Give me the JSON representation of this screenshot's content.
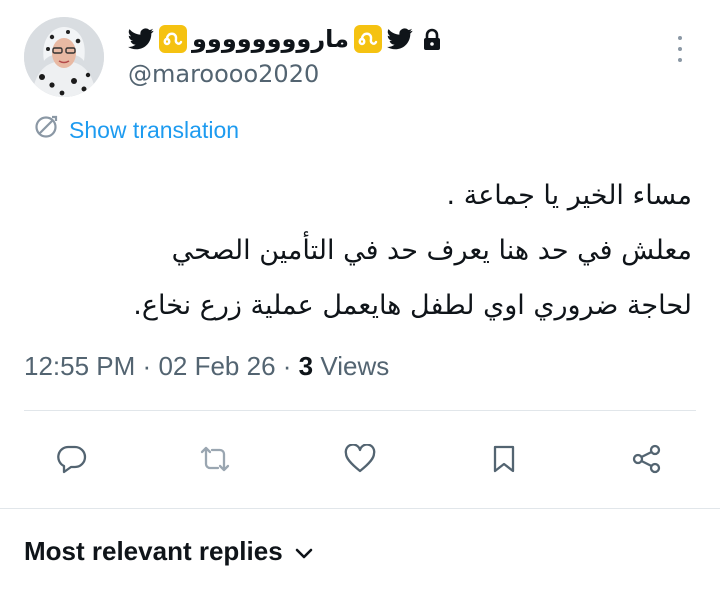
{
  "tweet": {
    "author": {
      "display_name": "ماروووووووو",
      "handle": "@maroooo2020",
      "icons": [
        "twitter-bird-icon",
        "leo-zodiac-icon",
        "leo-zodiac-icon",
        "twitter-bird-icon",
        "lock-icon"
      ]
    },
    "translate_label": "Show translation",
    "text_lines": [
      "مساء الخير يا جماعة .",
      "معلش في حد هنا يعرف حد في التأمين الصحي",
      "لحاجة ضروري اوي لطفل هايعمل عملية زرع نخاع."
    ],
    "meta": {
      "time": "12:55 PM",
      "separator": "·",
      "date": "02 Feb 26",
      "views_count": "3",
      "views_label": "Views"
    },
    "actions": [
      "reply-icon",
      "retweet-icon",
      "like-icon",
      "bookmark-icon",
      "share-icon"
    ]
  },
  "replies_section": {
    "label": "Most relevant replies"
  },
  "colors": {
    "link": "#1d9bf0",
    "text": "#0f1419",
    "secondary": "#536471",
    "icon": "#536471",
    "divider": "#e1e6ea",
    "zodiac": "#f5c211"
  }
}
